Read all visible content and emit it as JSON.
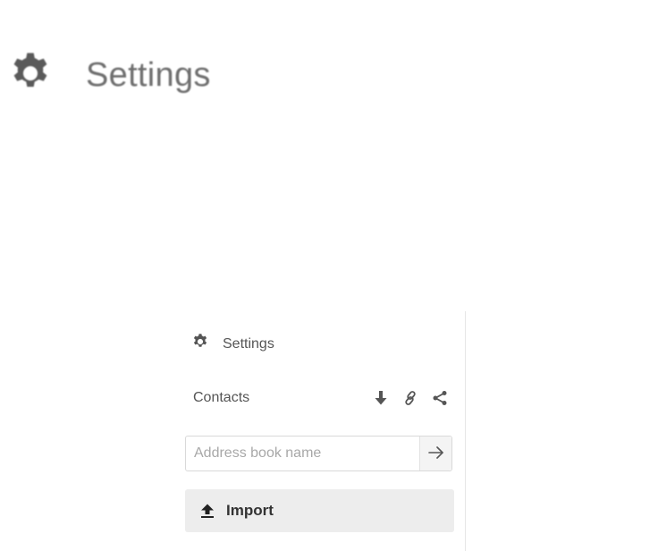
{
  "header": {
    "title": "Settings",
    "icon": "gear-icon"
  },
  "panel": {
    "settings_label": "Settings",
    "settings_icon": "gear-icon",
    "contacts": {
      "label": "Contacts",
      "actions": [
        {
          "icon": "download-icon"
        },
        {
          "icon": "link-icon"
        },
        {
          "icon": "share-icon"
        }
      ]
    },
    "address_book": {
      "placeholder": "Address book name",
      "value": "",
      "submit_icon": "arrow-right-icon"
    },
    "import": {
      "label": "Import",
      "icon": "upload-icon"
    }
  },
  "colors": {
    "icon": "#555555",
    "text": "#555555",
    "import_bg": "#ededed",
    "border": "#d9d9d9"
  }
}
